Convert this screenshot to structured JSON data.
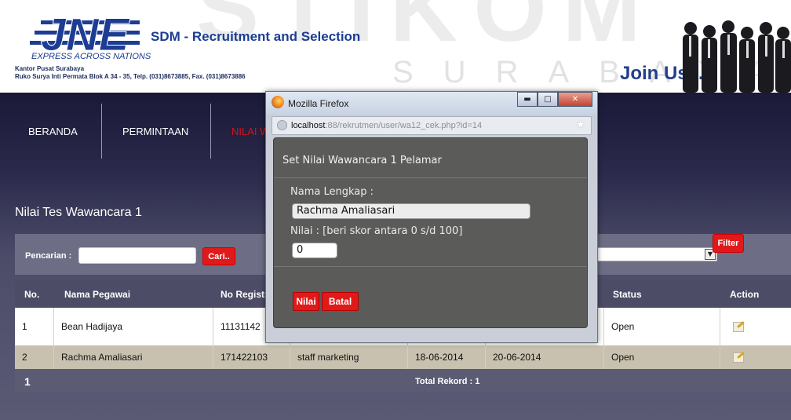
{
  "header": {
    "app_title": "SDM - Recruitment and Selection",
    "logo_text": "JNE",
    "logo_tagline": "EXPRESS ACROSS NATIONS",
    "office_name": "Kantor Pusat Surabaya",
    "office_address": "Ruko Surya Inti Permata Blok A 34 - 35, Telp. (031)8673885, Fax. (031)8673886",
    "join_text": "Join Us...",
    "watermark": "STIKOM",
    "watermark_sub": "SURABAYA"
  },
  "nav": {
    "items": [
      "BERANDA",
      "PERMINTAAN",
      "NILAI W"
    ]
  },
  "page": {
    "title": "Nilai Tes Wawancara 1"
  },
  "search": {
    "label": "Pencarian :",
    "value": "",
    "button": "Cari..",
    "filter_value": "",
    "filter_button": "Filter"
  },
  "table": {
    "headers": [
      "No.",
      "Nama Pegawai",
      "No Registr",
      "Status",
      "Action"
    ],
    "rows": [
      {
        "no": "1",
        "nama": "Bean Hadijaya",
        "reg": "11131142",
        "jabatan": "",
        "tgl1": "",
        "tgl2": "",
        "status": "Open"
      },
      {
        "no": "2",
        "nama": "Rachma Amaliasari",
        "reg": "171422103",
        "jabatan": "staff marketing",
        "tgl1": "18-06-2014",
        "tgl2": "20-06-2014",
        "status": "Open"
      }
    ],
    "page": "1",
    "total": "Total Rekord : 1"
  },
  "popup": {
    "window_title": "Mozilla Firefox",
    "url_host": "localhost",
    "url_rest": ":88/rekrutmen/user/wa12_cek.php?id=14",
    "dialog_title": "Set Nilai Wawancara 1 Pelamar",
    "name_label": "Nama Lengkap :",
    "name_value": "Rachma Amaliasari",
    "score_label": "Nilai : [beri skor antara 0 s/d 100]",
    "score_value": "0",
    "submit_button": "Nilai",
    "cancel_button": "Batal"
  }
}
